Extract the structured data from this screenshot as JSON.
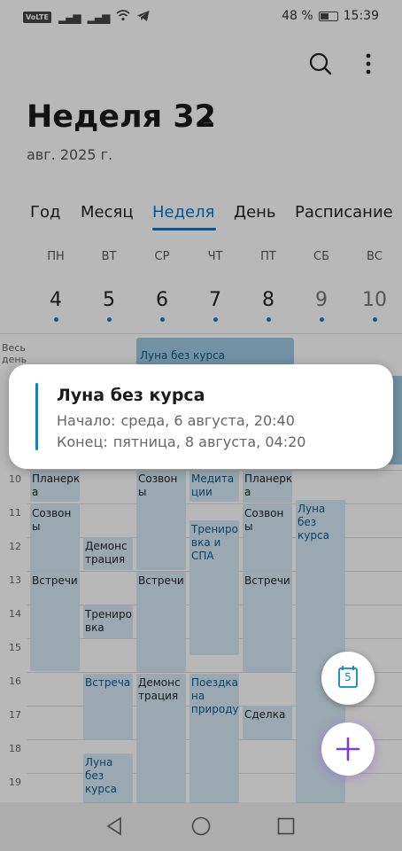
{
  "status_bar": {
    "volte": "VoLTE",
    "battery": "48 %",
    "time": "15:39"
  },
  "header": {
    "title": "Неделя 32",
    "subtitle": "авг. 2025 г."
  },
  "tabs": [
    {
      "label": "Год"
    },
    {
      "label": "Месяц"
    },
    {
      "label": "Неделя",
      "active": true
    },
    {
      "label": "День"
    },
    {
      "label": "Расписание"
    }
  ],
  "days": [
    {
      "dow": "ПН",
      "num": "4"
    },
    {
      "dow": "ВТ",
      "num": "5"
    },
    {
      "dow": "СР",
      "num": "6"
    },
    {
      "dow": "ЧТ",
      "num": "7"
    },
    {
      "dow": "ПТ",
      "num": "8"
    },
    {
      "dow": "СБ",
      "num": "9"
    },
    {
      "dow": "ВС",
      "num": "10"
    }
  ],
  "allday": {
    "label_line1": "Весь",
    "label_line2": "день",
    "event": "Луна без курса"
  },
  "hours": [
    "10",
    "11",
    "12",
    "13",
    "14",
    "15",
    "16",
    "17",
    "18",
    "19"
  ],
  "events": {
    "mon_planerka": "Планерк\nа",
    "mon_sozvony": "Созвон\nы",
    "mon_vstrechi": "Встречи",
    "tue_demo": "Демонс\nтрация",
    "tue_trenirovka": "Трениро\nвка",
    "tue_vstrecha": "Встреча",
    "tue_luna": "Луна без\nкурса",
    "wed_sozvony": "Созвон\nы",
    "wed_vstrechi": "Встречи",
    "wed_demo": "Демонс\nтрация",
    "thu_meditacii": "Медита\nции",
    "thu_trenirovki": "Трениро\nвка и\nСПА",
    "thu_poezdka": "Поездка\nна\nприроду",
    "fri_planerka": "Планерк\nа",
    "fri_sozvony": "Созвон\nы",
    "fri_vstrechi": "Встречи",
    "fri_sdelka": "Сделка",
    "sat_luna": "Луна без\nкурса"
  },
  "popup": {
    "title": "Луна без курса",
    "start_label": "Начало:",
    "start_value": "среда, 6 августа, 20:40",
    "end_label": "Конец:",
    "end_value": "пятница, 8 августа, 04:20"
  },
  "fab_today": {
    "day": "5"
  },
  "colors": {
    "accent": "#0078d4",
    "event_bg": "#d6e9f6",
    "event_bar": "#0b84c6",
    "fab_plus": "#7a3fd0"
  }
}
